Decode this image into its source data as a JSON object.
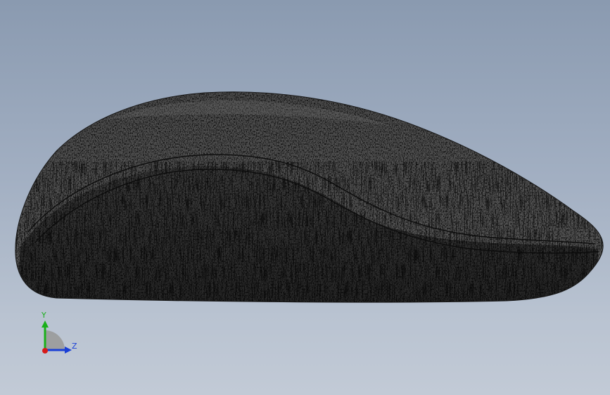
{
  "viewport": {
    "background_top": "#8a9ab0",
    "background_bottom": "#c2cad6"
  },
  "model": {
    "name": "mouse-shell",
    "surface_color": "#3a3a3a",
    "edge_color": "#0c0c0c"
  },
  "triad": {
    "y_label": "Y",
    "z_label": "Z",
    "y_color": "#1ab01a",
    "z_color": "#1a3fd6",
    "x_color": "#d61a1a"
  }
}
